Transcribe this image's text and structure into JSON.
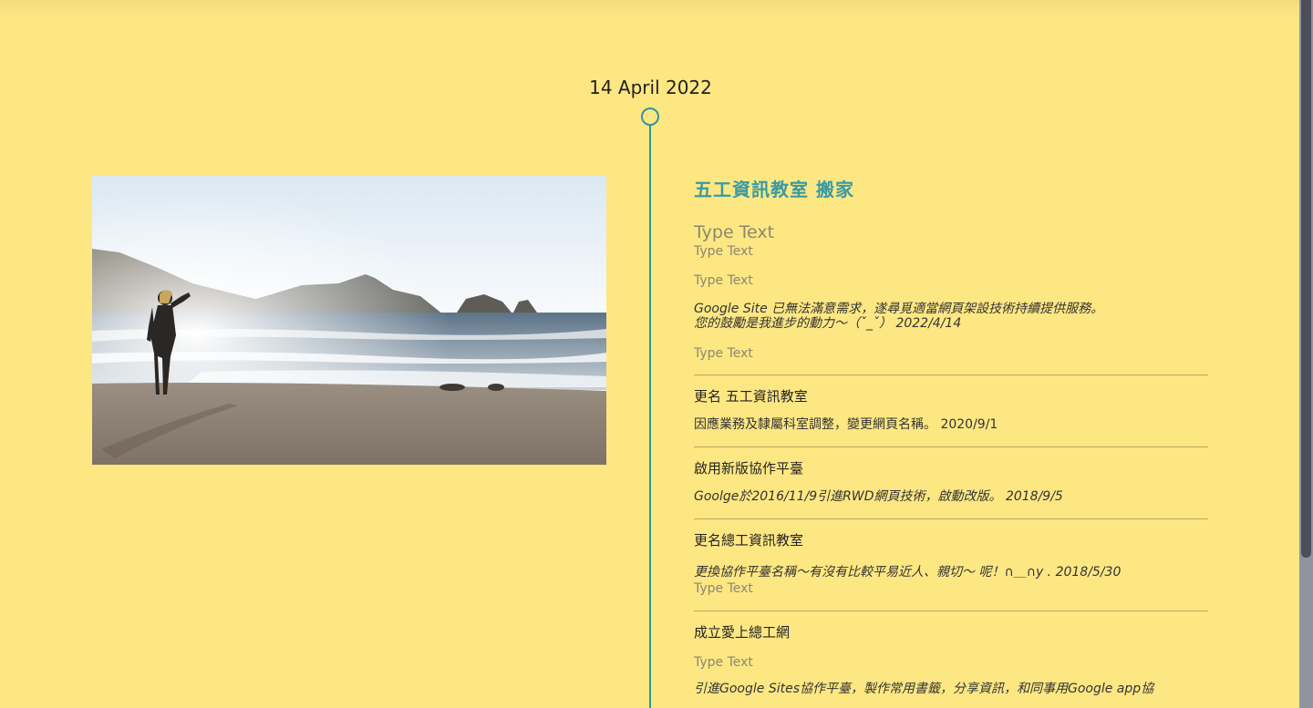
{
  "timeline": {
    "date": "14 April 2022"
  },
  "photo": {
    "alt": "woman walking on beach"
  },
  "post": {
    "title": "五工資訊教室 搬家",
    "placeholder_big": "Type Text",
    "placeholder_1": "Type Text",
    "placeholder_2": "Type Text",
    "move_line1": "Google Site 已無法滿意需求，遂尋覓適當網頁架設技術持續提供服務。",
    "move_line2": "您的鼓勵是我進步的動力～（ˇ_ˇ） 2022/4/14",
    "placeholder_3": "Type Text",
    "entries": [
      {
        "heading": "更名 五工資訊教室",
        "text": "因應業務及隸屬科室調整，變更網頁名稱。  2020/9/1"
      },
      {
        "heading": "啟用新版協作平臺",
        "text": "Goolge於2016/11/9引進RWD網頁技術，啟動改版。  2018/9/5"
      },
      {
        "heading": "更名總工資訊教室",
        "text": "更換協作平臺名稱～有沒有比較平易近人、親切～ 呢！∩＿∩y . 2018/5/30",
        "placeholder": "Type Text"
      },
      {
        "heading": "成立愛上總工網",
        "placeholder": "Type Text",
        "text": "引進Google Sites協作平臺，製作常用書籤，分享資訊，和同事用Google app協"
      }
    ]
  },
  "colors": {
    "background": "#fde783",
    "accent": "#3a9aa3",
    "timeline": "#34949a"
  }
}
